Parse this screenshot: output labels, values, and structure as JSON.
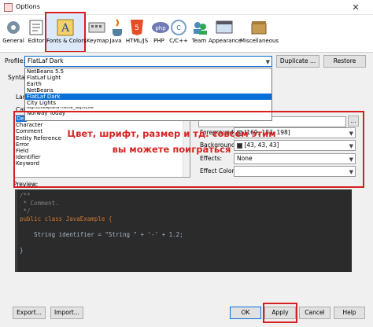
{
  "window": {
    "title": "Options",
    "close_glyph": "✕"
  },
  "toolbar": {
    "items": [
      {
        "label": "General",
        "icon": "general-icon"
      },
      {
        "label": "Editor",
        "icon": "editor-icon"
      },
      {
        "label": "Fonts & Colors",
        "icon": "fonts-colors-icon",
        "selected": true
      },
      {
        "label": "Keymap",
        "icon": "keymap-icon"
      },
      {
        "label": "Java",
        "icon": "java-icon"
      },
      {
        "label": "HTML/JS",
        "icon": "html5-icon"
      },
      {
        "label": "PHP",
        "icon": "php-icon"
      },
      {
        "label": "C/C++",
        "icon": "cpp-icon"
      },
      {
        "label": "Team",
        "icon": "team-icon"
      },
      {
        "label": "Appearance",
        "icon": "appearance-icon"
      },
      {
        "label": "Miscellaneous",
        "icon": "misc-icon"
      }
    ]
  },
  "profile": {
    "label": "Profile:",
    "value": "FlatLaf Dark",
    "duplicate": "Duplicate ...",
    "restore": "Restore",
    "options": [
      "NetBeans 5.5",
      "FlatLaf Light",
      "Earth",
      "NetBeans",
      "FlatLaf Dark",
      "City Lights",
      "NightLiveAptanaTheme_NightLive",
      "Norway Today"
    ],
    "selected_index": 4
  },
  "tabs": {
    "partial_syntax": "Syntax"
  },
  "partial_labels": {
    "language": "Lan",
    "category": "Cat"
  },
  "categories": {
    "items": [
      "Default",
      "Character",
      "Comment",
      "Entity Reference",
      "Error",
      "Field",
      "Identifier",
      "Keyword"
    ],
    "selected_index": 0,
    "selected_visible_text": "Def"
  },
  "annotation": {
    "text": "Цвет, шрифт, размер и тд. совсем этим вы можете поиграться"
  },
  "properties": {
    "font_value": "",
    "foreground_label": "Foreground:",
    "foreground_value": "[169, 183, 198]",
    "foreground_color": "#a9b7c6",
    "background_label": "Background:",
    "background_value": "[43, 43, 43]",
    "background_color": "#2b2b2b",
    "effects_label": "Effects:",
    "effects_value": "None",
    "effect_color_label": "Effect Color:",
    "effect_color_value": "",
    "browse": "..."
  },
  "preview": {
    "label": "Preview:",
    "lines": [
      "/**",
      " * Comment.",
      " */",
      "public class JavaExample {",
      "",
      "    String identifier = \"String \" + '-' + 1.2;",
      "",
      "}"
    ]
  },
  "bottom": {
    "export": "Export...",
    "import": "Import...",
    "ok": "OK",
    "apply": "Apply",
    "cancel": "Cancel",
    "help": "Help"
  }
}
